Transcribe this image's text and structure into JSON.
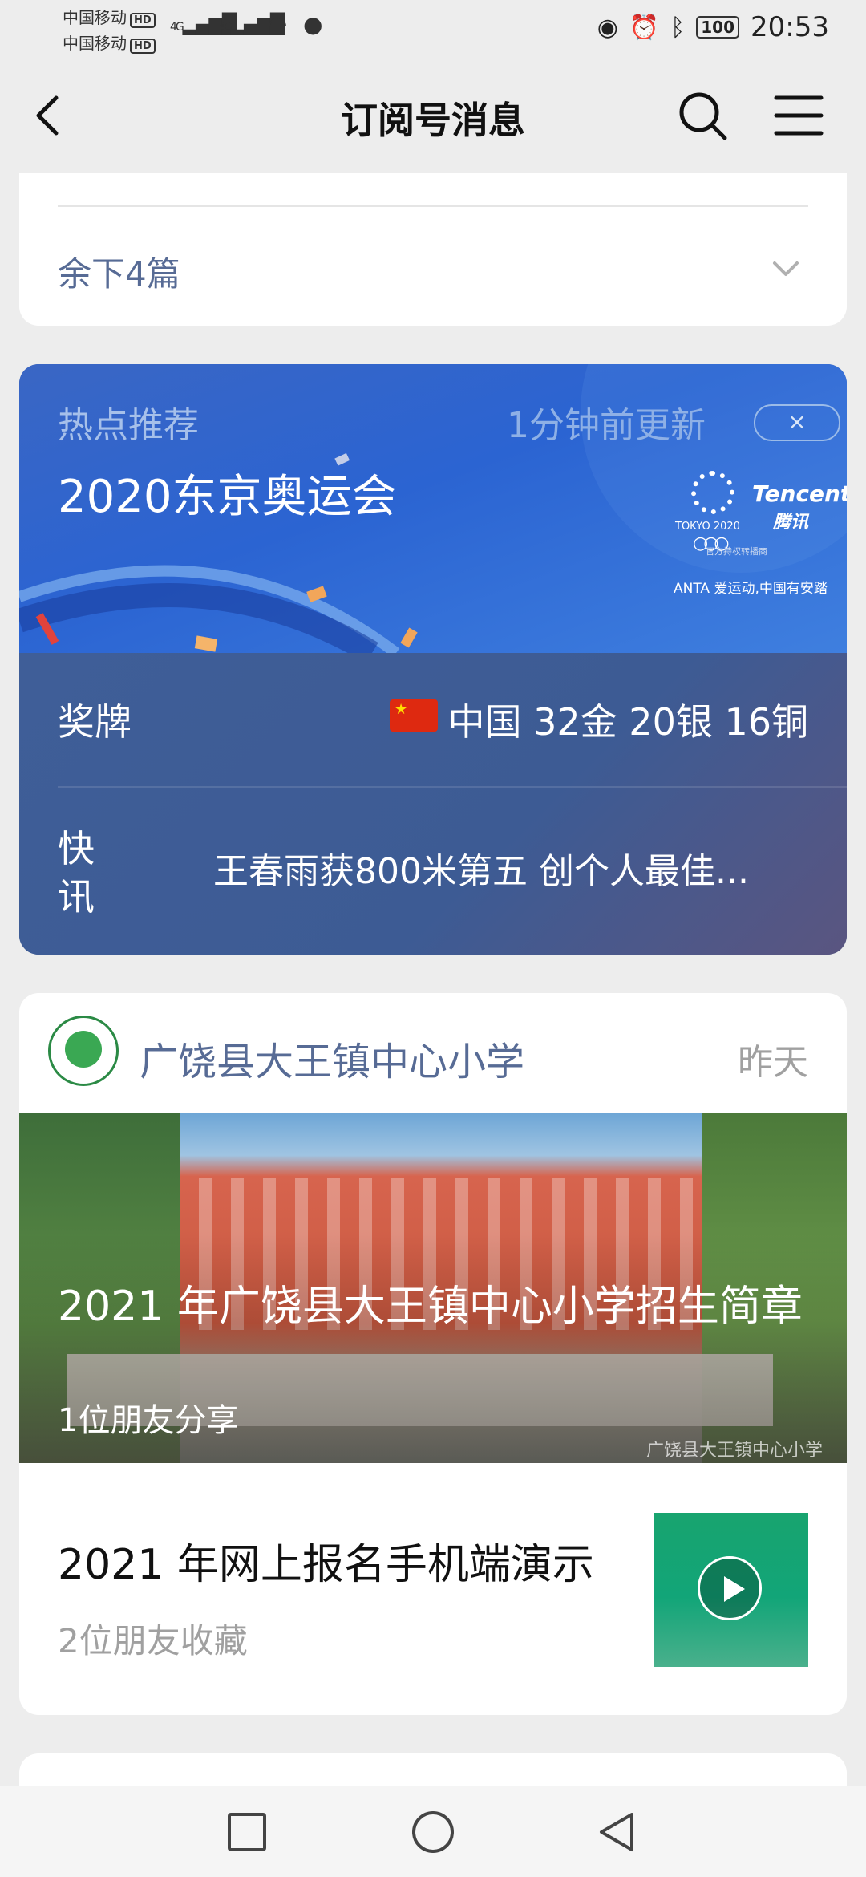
{
  "status_bar": {
    "carrier1": "中国移动",
    "carrier2": "中国移动",
    "hd": "HD",
    "net1": "4G",
    "net2": "4G",
    "battery": "100",
    "time": "20:53"
  },
  "navbar": {
    "title": "订阅号消息"
  },
  "card1": {
    "remaining": "余下4篇"
  },
  "hot": {
    "label": "热点推荐",
    "updated": "1分钟前更新",
    "close": "×",
    "headline": "2020东京奥运会",
    "logo": {
      "tokyo": "TOKYO 2020",
      "tencent": "Tencent",
      "tencent_cn": "腾讯",
      "partner": "官方持权转播商",
      "anta": "ANTA 爱运动,中国有安踏"
    },
    "medal_label": "奖牌",
    "medal_value": "中国 32金 20银 16铜",
    "flash_label": "快讯",
    "flash_text": "王春雨获800米第五 创个人最佳..."
  },
  "account": {
    "name": "广饶县大王镇中心小学",
    "time": "昨天",
    "article1": {
      "title": "2021 年广饶县大王镇中心小学招生简章",
      "sub": "1位朋友分享",
      "watermark": "广饶县大王镇中心小学"
    },
    "article2": {
      "title": "2021 年网上报名手机端演示",
      "sub": "2位朋友收藏"
    }
  },
  "colors": {
    "link_blue": "#576b95",
    "hot_bg": "#3f5e98",
    "page_bg": "#ededed"
  }
}
